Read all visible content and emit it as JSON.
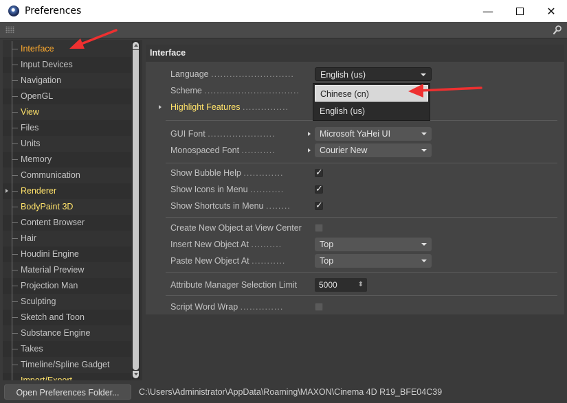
{
  "window": {
    "title": "Preferences",
    "minimize_glyph": "—",
    "close_glyph": "✕"
  },
  "sidebar": {
    "items": [
      {
        "label": "Interface",
        "style": "active"
      },
      {
        "label": "Input Devices",
        "style": "normal"
      },
      {
        "label": "Navigation",
        "style": "normal"
      },
      {
        "label": "OpenGL",
        "style": "normal"
      },
      {
        "label": "View",
        "style": "yellow"
      },
      {
        "label": "Files",
        "style": "normal"
      },
      {
        "label": "Units",
        "style": "normal"
      },
      {
        "label": "Memory",
        "style": "normal"
      },
      {
        "label": "Communication",
        "style": "normal"
      },
      {
        "label": "Renderer",
        "style": "yellow",
        "expandable": true
      },
      {
        "label": "BodyPaint 3D",
        "style": "yellow"
      },
      {
        "label": "Content Browser",
        "style": "normal"
      },
      {
        "label": "Hair",
        "style": "normal"
      },
      {
        "label": "Houdini Engine",
        "style": "normal"
      },
      {
        "label": "Material Preview",
        "style": "normal"
      },
      {
        "label": "Projection Man",
        "style": "normal"
      },
      {
        "label": "Sculpting",
        "style": "normal"
      },
      {
        "label": "Sketch and Toon",
        "style": "normal"
      },
      {
        "label": "Substance Engine",
        "style": "normal"
      },
      {
        "label": "Takes",
        "style": "normal"
      },
      {
        "label": "Timeline/Spline Gadget",
        "style": "normal"
      },
      {
        "label": "Import/Export",
        "style": "yellow"
      }
    ]
  },
  "main": {
    "header": "Interface",
    "language": {
      "label": "Language",
      "value": "English (us)"
    },
    "scheme": {
      "label": "Scheme"
    },
    "highlight": {
      "label": "Highlight Features"
    },
    "language_options": [
      "Chinese (cn)",
      "English (us)"
    ],
    "gui_font": {
      "label": "GUI Font",
      "value": "Microsoft YaHei UI"
    },
    "mono_font": {
      "label": "Monospaced Font",
      "value": "Courier New"
    },
    "bubble_help": {
      "label": "Show Bubble Help"
    },
    "icons_menu": {
      "label": "Show Icons in Menu"
    },
    "shortcuts_menu": {
      "label": "Show Shortcuts in Menu"
    },
    "create_center": {
      "label": "Create New Object at View Center"
    },
    "insert_at": {
      "label": "Insert New Object At",
      "value": "Top"
    },
    "paste_at": {
      "label": "Paste New Object At",
      "value": "Top"
    },
    "attr_limit": {
      "label": "Attribute Manager Selection Limit",
      "value": "5000",
      "spin": "⬍"
    },
    "word_wrap": {
      "label": "Script Word Wrap"
    }
  },
  "bottom": {
    "open_folder_label": "Open Preferences Folder...",
    "path": "C:\\Users\\Administrator\\AppData\\Roaming\\MAXON\\Cinema 4D R19_BFE04C39"
  },
  "colors": {
    "accent_active": "#ffab2e",
    "highlight_yellow": "#ffe26a",
    "annotation_red": "#ee3030"
  }
}
